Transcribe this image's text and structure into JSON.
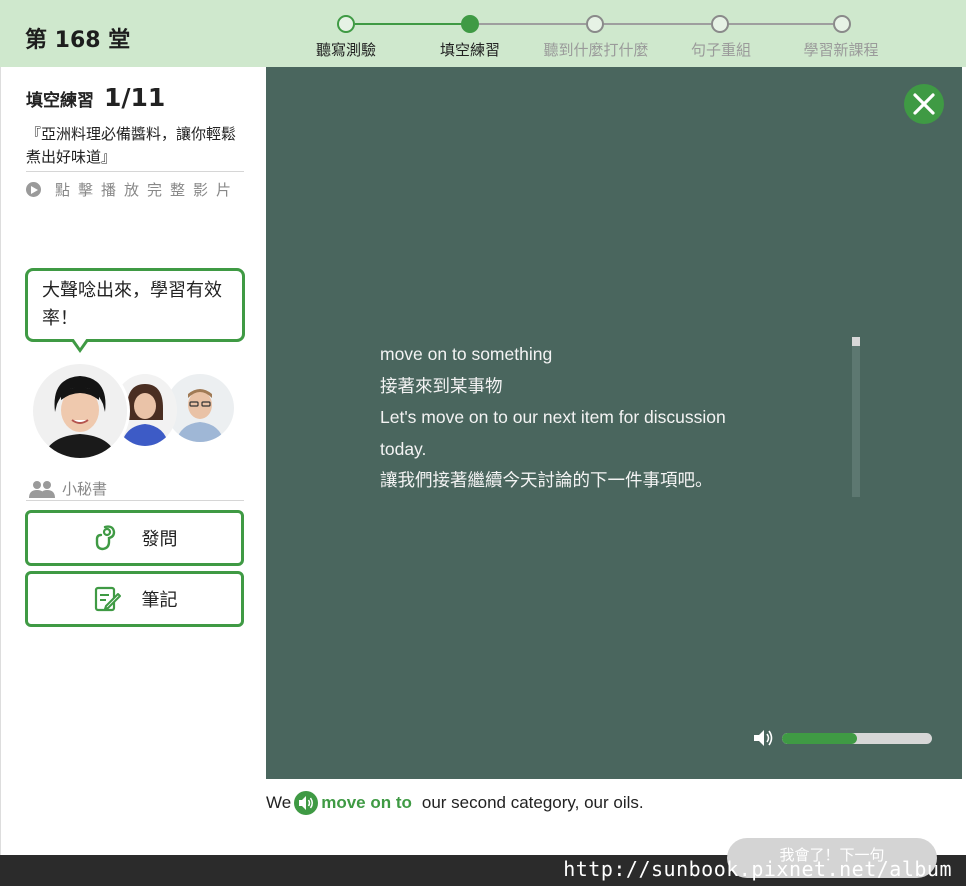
{
  "header": {
    "lesson_title": "第 168 堂",
    "steps": [
      {
        "label": "聽寫測驗",
        "state": "done"
      },
      {
        "label": "填空練習",
        "state": "active"
      },
      {
        "label": "聽到什麼打什麼",
        "state": "todo"
      },
      {
        "label": "句子重組",
        "state": "todo"
      },
      {
        "label": "學習新課程",
        "state": "todo"
      }
    ]
  },
  "sidebar": {
    "exercise_label": "填空練習",
    "exercise_count": "1/11",
    "description": "『亞洲料理必備醬料，讓你輕鬆煮出好味道』",
    "play_full_video": "點擊播放完整影片",
    "speech_bubble": "大聲唸出來，學習有效率！",
    "secretary_label": "小秘書",
    "ask_button": "發問",
    "notes_button": "筆記"
  },
  "panel": {
    "lines": [
      "move on to something",
      "接著來到某事物",
      "Let's move on to our next item for discussion today.",
      "讓我們接著繼續今天討論的下一件事項吧。"
    ],
    "volume_level": 0.5
  },
  "sentence": {
    "before": "We",
    "phrase": "move on to",
    "after": "our second category, our oils."
  },
  "footer": {
    "next_button": "我會了！下一句",
    "watermark": "http://sunbook.pixnet.net/album"
  },
  "colors": {
    "accent": "#3f9a44",
    "header_bg": "#cfe8cd",
    "panel_bg": "#4a665e"
  }
}
